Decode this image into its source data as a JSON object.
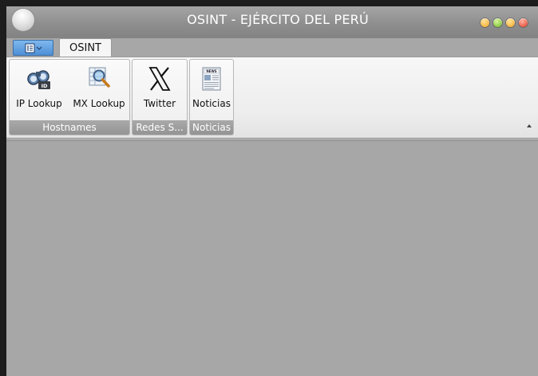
{
  "window": {
    "title": "OSINT - EJÉRCITO DEL PERÚ"
  },
  "tabs": {
    "active": "OSINT"
  },
  "ribbon": {
    "groups": [
      {
        "label": "Hostnames",
        "buttons": [
          {
            "label": "IP Lookup",
            "icon": "binoculars-id-icon"
          },
          {
            "label": "MX Lookup",
            "icon": "magnifier-table-icon"
          }
        ]
      },
      {
        "label": "Redes S...",
        "buttons": [
          {
            "label": "Twitter",
            "icon": "x-logo-icon"
          }
        ]
      },
      {
        "label": "Noticias",
        "buttons": [
          {
            "label": "Noticias",
            "icon": "newspaper-icon"
          }
        ]
      }
    ]
  },
  "colors": {
    "titlebar": "#8e8e8e",
    "ribbon": "#ededed",
    "group_label_bg": "#a0a0a0",
    "content": "#a7a7a7",
    "file_button": "#5a9ae0"
  }
}
